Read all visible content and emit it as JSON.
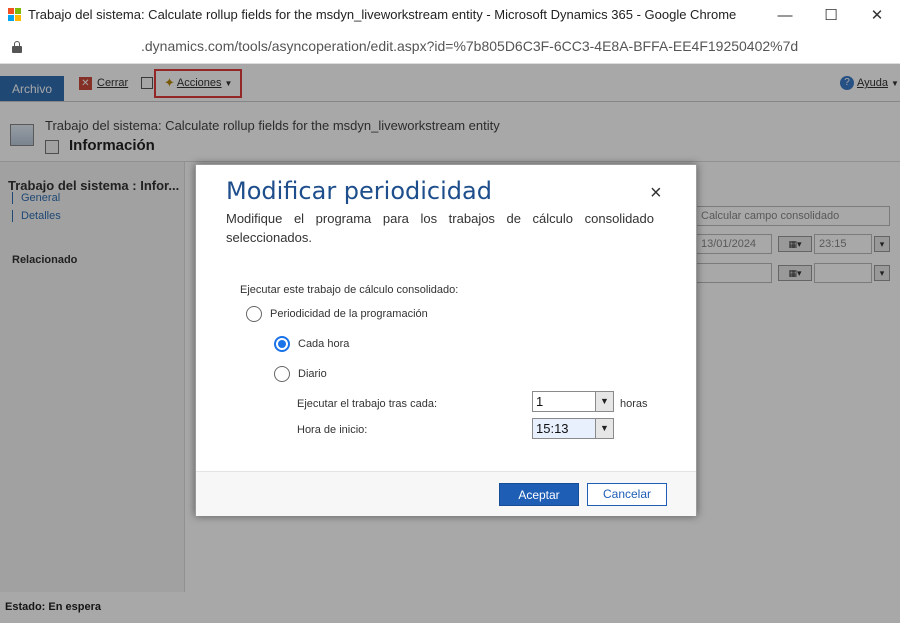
{
  "browser": {
    "title": "Trabajo del sistema: Calculate rollup fields for the msdyn_liveworkstream entity - Microsoft Dynamics 365 - Google Chrome",
    "url": ".dynamics.com/tools/asyncoperation/edit.aspx?id=%7b805D6C3F-6CC3-4E8A-BFFA-EE4F19250402%7d",
    "controls": {
      "minimize": "—",
      "maximize": "☐",
      "close": "✕"
    }
  },
  "ribbon": {
    "archivo": "Archivo",
    "cerrar": "Cerrar",
    "acciones": "Acciones",
    "ayuda": "Ayuda"
  },
  "form_header": {
    "entity_line": "Trabajo del sistema: Calculate rollup fields for the msdyn_liveworkstream entity",
    "title": "Información"
  },
  "left_nav": {
    "title": "Trabajo del sistema : Infor...",
    "links": [
      "General",
      "Detalles"
    ],
    "related": "Relacionado"
  },
  "background_fields": {
    "operation": "Calcular campo consolidado",
    "date": "13/01/2024",
    "time": "23:15"
  },
  "status": "Estado: En espera",
  "dialog": {
    "title": "Modificar periodicidad",
    "close": "×",
    "description": "Modifique el programa para los trabajos de cálculo consolidado seleccionados.",
    "question": "Ejecutar este trabajo de cálculo consolidado:",
    "option_schedule": "Periodicidad de la programación",
    "option_hourly": "Cada hora",
    "option_daily": "Diario",
    "run_after_label": "Ejecutar el trabajo tras cada:",
    "run_after_value": "1",
    "run_after_unit": "horas",
    "start_time_label": "Hora de inicio:",
    "start_time_value": "15:13",
    "accept": "Aceptar",
    "cancel": "Cancelar"
  }
}
